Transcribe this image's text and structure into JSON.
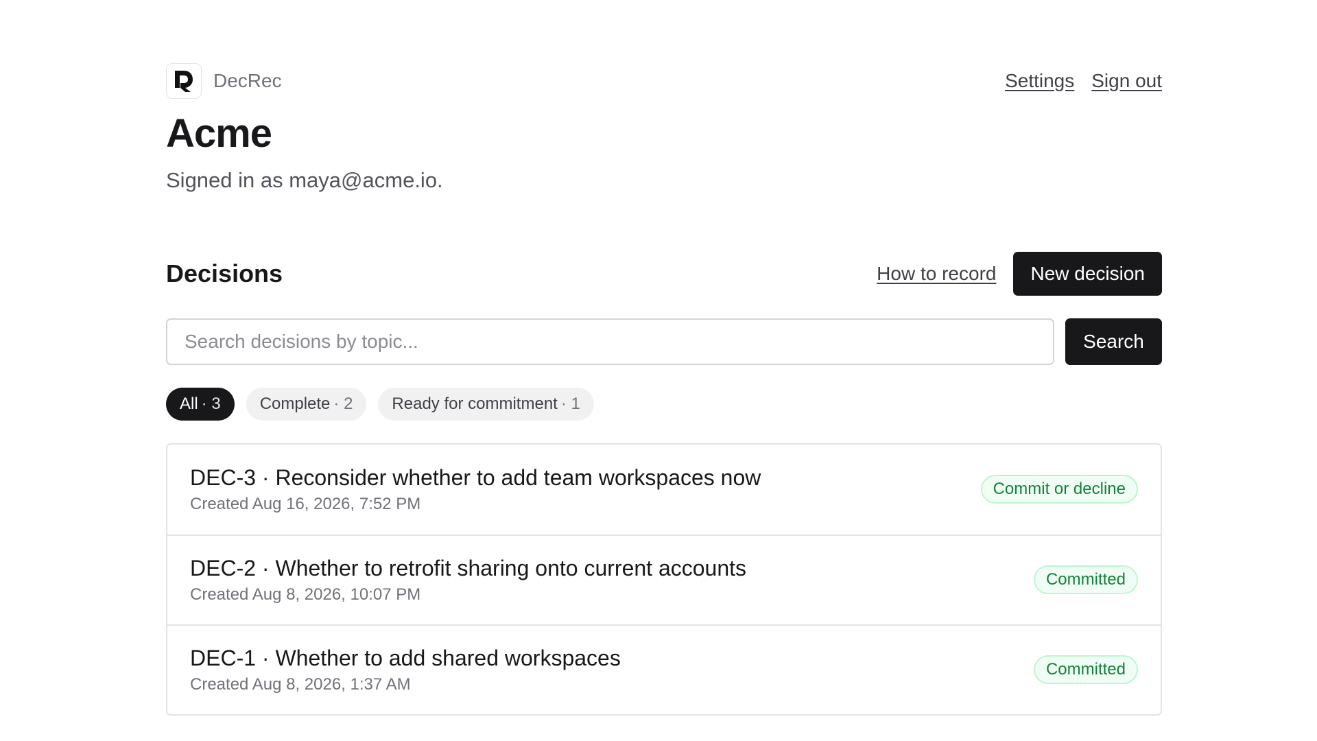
{
  "app": {
    "name": "DecRec"
  },
  "nav": {
    "settings": "Settings",
    "sign_out": "Sign out"
  },
  "org": {
    "name": "Acme",
    "signed_in": "Signed in as maya@acme.io."
  },
  "decisions": {
    "title": "Decisions",
    "how_to": "How to record",
    "new_label": "New decision",
    "search": {
      "placeholder": "Search decisions by topic...",
      "button": "Search"
    },
    "filters": [
      {
        "label": "All",
        "count": "· 3",
        "active": true
      },
      {
        "label": "Complete",
        "count": "· 2",
        "active": false
      },
      {
        "label": "Ready for commitment",
        "count": "· 1",
        "active": false
      }
    ],
    "items": [
      {
        "title": "DEC-3 · Reconsider whether to add team workspaces now",
        "created": "Created Aug 16, 2026, 7:52 PM",
        "status": "Commit or decline"
      },
      {
        "title": "DEC-2 · Whether to retrofit sharing onto current accounts",
        "created": "Created Aug 8, 2026, 10:07 PM",
        "status": "Committed"
      },
      {
        "title": "DEC-1 · Whether to add shared workspaces",
        "created": "Created Aug 8, 2026, 1:37 AM",
        "status": "Committed"
      }
    ]
  },
  "colors": {
    "accent": "#18181b",
    "success_text": "#15803d",
    "success_bg": "#f0fdf4"
  },
  "icons": {
    "logo": "decrec-logo-icon"
  }
}
